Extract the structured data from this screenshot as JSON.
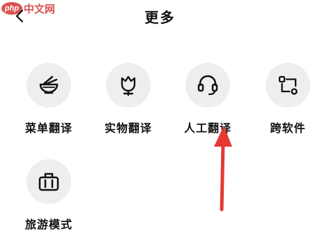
{
  "watermark": {
    "logo_text": "php",
    "site_text": "中文网"
  },
  "header": {
    "title": "更多",
    "back_icon": "chevron-left-icon"
  },
  "items": [
    {
      "label": "菜单翻译",
      "icon": "bowl-noodles-icon"
    },
    {
      "label": "实物翻译",
      "icon": "tulip-icon"
    },
    {
      "label": "人工翻译",
      "icon": "headset-icon"
    },
    {
      "label": "跨软件",
      "icon": "share-nodes-icon"
    },
    {
      "label": "旅游模式",
      "icon": "suitcase-icon"
    }
  ],
  "colors": {
    "icon_bg": "#eeeeee",
    "arrow": "#e53935",
    "watermark": "#d9534f"
  }
}
